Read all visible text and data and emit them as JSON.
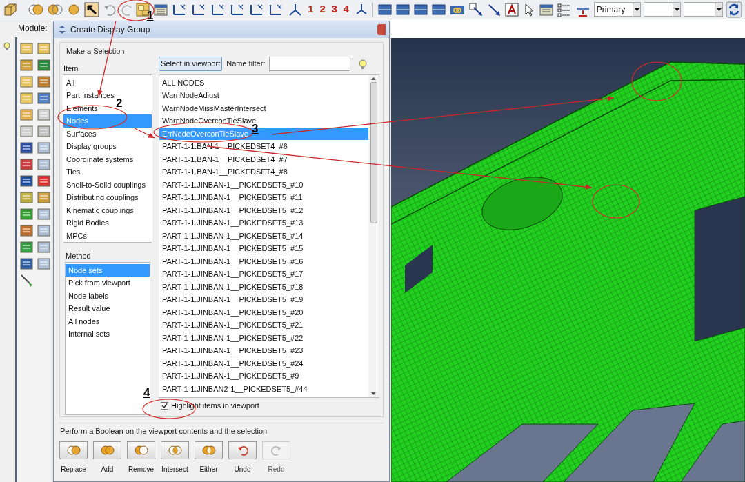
{
  "toolbar": {
    "view_buttons": [
      "1",
      "2",
      "3",
      "4"
    ],
    "selection_combo": {
      "value": "Primary"
    }
  },
  "module_label": "Module:",
  "dialog": {
    "title": "Create Display Group",
    "selection_group": {
      "label": "Make a Selection",
      "item_label": "Item",
      "items": [
        {
          "label": "All",
          "selected": false
        },
        {
          "label": "Part instances",
          "selected": false
        },
        {
          "label": "Elements",
          "selected": false
        },
        {
          "label": "Nodes",
          "selected": true
        },
        {
          "label": "Surfaces",
          "selected": false
        },
        {
          "label": "Display groups",
          "selected": false
        },
        {
          "label": "Coordinate systems",
          "selected": false
        },
        {
          "label": "Ties",
          "selected": false
        },
        {
          "label": "Shell-to-Solid couplings",
          "selected": false
        },
        {
          "label": "Distributing couplings",
          "selected": false
        },
        {
          "label": "Kinematic couplings",
          "selected": false
        },
        {
          "label": "Rigid Bodies",
          "selected": false
        },
        {
          "label": "MPCs",
          "selected": false
        }
      ],
      "method_label": "Method",
      "methods": [
        {
          "label": "Node sets",
          "selected": true
        },
        {
          "label": "Pick from viewport",
          "selected": false
        },
        {
          "label": "Node labels",
          "selected": false
        },
        {
          "label": "Result value",
          "selected": false
        },
        {
          "label": "All nodes",
          "selected": false
        },
        {
          "label": "Internal sets",
          "selected": false
        }
      ],
      "select_button": "Select in viewport",
      "filter_label": "Name filter:",
      "sets": [
        {
          "label": "ALL NODES",
          "selected": false
        },
        {
          "label": "WarnNodeAdjust",
          "selected": false
        },
        {
          "label": "WarnNodeMissMasterIntersect",
          "selected": false
        },
        {
          "label": "WarnNodeOverconTieSlave",
          "selected": false
        },
        {
          "label": "ErrNodeOverconTieSlave",
          "selected": true
        },
        {
          "label": "PART-1-1.BAN-1__PICKEDSET4_#6",
          "selected": false
        },
        {
          "label": "PART-1-1.BAN-1__PICKEDSET4_#7",
          "selected": false
        },
        {
          "label": "PART-1-1.BAN-1__PICKEDSET4_#8",
          "selected": false
        },
        {
          "label": "PART-1-1.JINBAN-1__PICKEDSET5_#10",
          "selected": false
        },
        {
          "label": "PART-1-1.JINBAN-1__PICKEDSET5_#11",
          "selected": false
        },
        {
          "label": "PART-1-1.JINBAN-1__PICKEDSET5_#12",
          "selected": false
        },
        {
          "label": "PART-1-1.JINBAN-1__PICKEDSET5_#13",
          "selected": false
        },
        {
          "label": "PART-1-1.JINBAN-1__PICKEDSET5_#14",
          "selected": false
        },
        {
          "label": "PART-1-1.JINBAN-1__PICKEDSET5_#15",
          "selected": false
        },
        {
          "label": "PART-1-1.JINBAN-1__PICKEDSET5_#16",
          "selected": false
        },
        {
          "label": "PART-1-1.JINBAN-1__PICKEDSET5_#17",
          "selected": false
        },
        {
          "label": "PART-1-1.JINBAN-1__PICKEDSET5_#18",
          "selected": false
        },
        {
          "label": "PART-1-1.JINBAN-1__PICKEDSET5_#19",
          "selected": false
        },
        {
          "label": "PART-1-1.JINBAN-1__PICKEDSET5_#20",
          "selected": false
        },
        {
          "label": "PART-1-1.JINBAN-1__PICKEDSET5_#21",
          "selected": false
        },
        {
          "label": "PART-1-1.JINBAN-1__PICKEDSET5_#22",
          "selected": false
        },
        {
          "label": "PART-1-1.JINBAN-1__PICKEDSET5_#23",
          "selected": false
        },
        {
          "label": "PART-1-1.JINBAN-1__PICKEDSET5_#24",
          "selected": false
        },
        {
          "label": "PART-1-1.JINBAN-1__PICKEDSET5_#9",
          "selected": false
        },
        {
          "label": "PART-1-1.JINBAN2-1__PICKEDSET5_#44",
          "selected": false
        }
      ]
    },
    "highlight": {
      "label": "Highlight items in viewport",
      "checked": true
    },
    "boolean_group": {
      "label": "Perform a Boolean on the viewport contents and the selection",
      "buttons": [
        {
          "label": "Replace",
          "kind": "replace",
          "disabled": false
        },
        {
          "label": "Add",
          "kind": "add",
          "disabled": false
        },
        {
          "label": "Remove",
          "kind": "remove",
          "disabled": false
        },
        {
          "label": "Intersect",
          "kind": "intersect",
          "disabled": false
        },
        {
          "label": "Either",
          "kind": "either",
          "disabled": false
        },
        {
          "label": "Undo",
          "kind": "undo",
          "disabled": false
        },
        {
          "label": "Redo",
          "kind": "redo",
          "disabled": true
        }
      ]
    }
  },
  "annotations": [
    "1",
    "2",
    "3",
    "4"
  ]
}
